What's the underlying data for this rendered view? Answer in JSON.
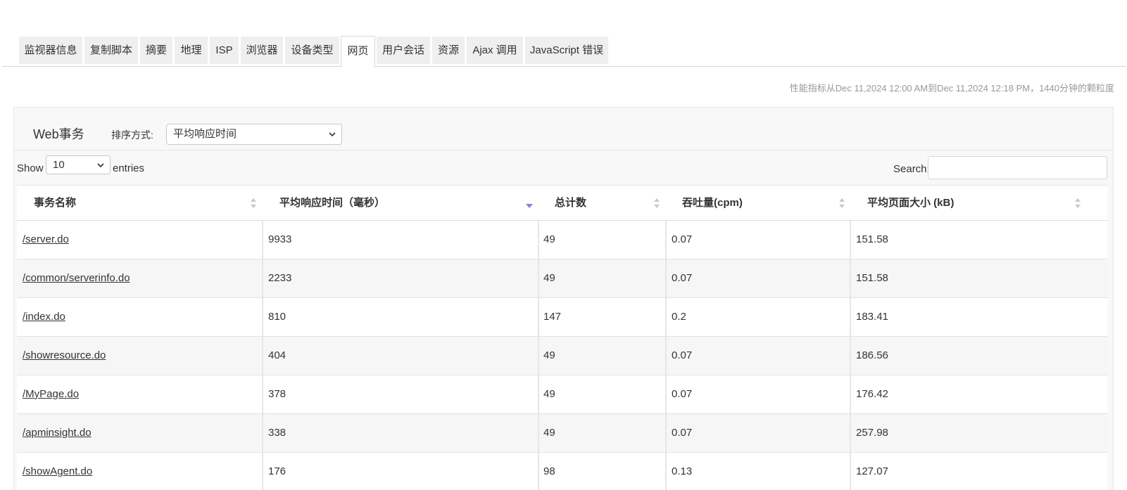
{
  "tabs": [
    {
      "label": "监视器信息",
      "active": false
    },
    {
      "label": "复制脚本",
      "active": false
    },
    {
      "label": "摘要",
      "active": false
    },
    {
      "label": "地理",
      "active": false
    },
    {
      "label": "ISP",
      "active": false
    },
    {
      "label": "浏览器",
      "active": false
    },
    {
      "label": "设备类型",
      "active": false
    },
    {
      "label": "网页",
      "active": true
    },
    {
      "label": "用户会话",
      "active": false
    },
    {
      "label": "资源",
      "active": false
    },
    {
      "label": "Ajax 调用",
      "active": false
    },
    {
      "label": "JavaScript 错误",
      "active": false
    }
  ],
  "period_note": "性能指标从Dec 11,2024 12:00 AM到Dec 11,2024 12:18 PM，1440分钟的颗粒度",
  "panel": {
    "title": "Web事务",
    "sort_label": "排序方式:",
    "sort_value": "平均响应时间"
  },
  "table_controls": {
    "show_label": "Show",
    "page_length": "10",
    "entries_label": "entries",
    "search_label": "Search:",
    "search_value": ""
  },
  "table": {
    "columns": [
      "事务名称",
      "平均响应时间（毫秒）",
      "总计数",
      "吞吐量(cpm)",
      "平均页面大小 (kB)"
    ],
    "sorted_column": 1,
    "sort_direction": "desc",
    "rows": [
      [
        "/server.do",
        "9933",
        "49",
        "0.07",
        "151.58"
      ],
      [
        "/common/serverinfo.do",
        "2233",
        "49",
        "0.07",
        "151.58"
      ],
      [
        "/index.do",
        "810",
        "147",
        "0.2",
        "183.41"
      ],
      [
        "/showresource.do",
        "404",
        "49",
        "0.07",
        "186.56"
      ],
      [
        "/MyPage.do",
        "378",
        "49",
        "0.07",
        "176.42"
      ],
      [
        "/apminsight.do",
        "338",
        "49",
        "0.07",
        "257.98"
      ],
      [
        "/showAgent.do",
        "176",
        "98",
        "0.13",
        "127.07"
      ]
    ]
  },
  "colors": {
    "tab_bg": "#efefef",
    "active_tab_bg": "#ffffff",
    "panel_bg": "#f8f8f8",
    "sort_active": "#7b86d6",
    "sort_inactive": "#c8c8c8"
  }
}
